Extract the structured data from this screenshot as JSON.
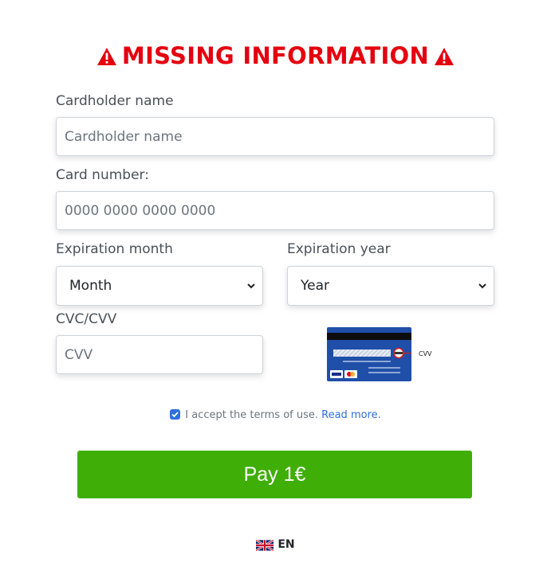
{
  "header": {
    "title": "MISSING INFORMATION"
  },
  "form": {
    "cardholder_label": "Cardholder name",
    "cardholder_placeholder": "Cardholder name",
    "card_number_label": "Card number:",
    "card_number_placeholder": "0000 0000 0000 0000",
    "exp_month_label": "Expiration month",
    "exp_month_value": "Month",
    "exp_year_label": "Expiration year",
    "exp_year_value": "Year",
    "cvc_label": "CVC/CVV",
    "cvc_placeholder": "CVV",
    "cvv_hint": "CVV"
  },
  "terms": {
    "checked": true,
    "text": "I accept the terms of use.",
    "link": "Read more."
  },
  "pay_button": {
    "label": "Pay 1€"
  },
  "language": {
    "code": "EN"
  },
  "colors": {
    "title": "#e4000f",
    "pay": "#3fae06",
    "link": "#2f6fe0"
  },
  "icons": {
    "title_icons": "warning-icon",
    "card_hint": "credit-card-back-icon",
    "language_flag": "uk-flag-icon"
  }
}
